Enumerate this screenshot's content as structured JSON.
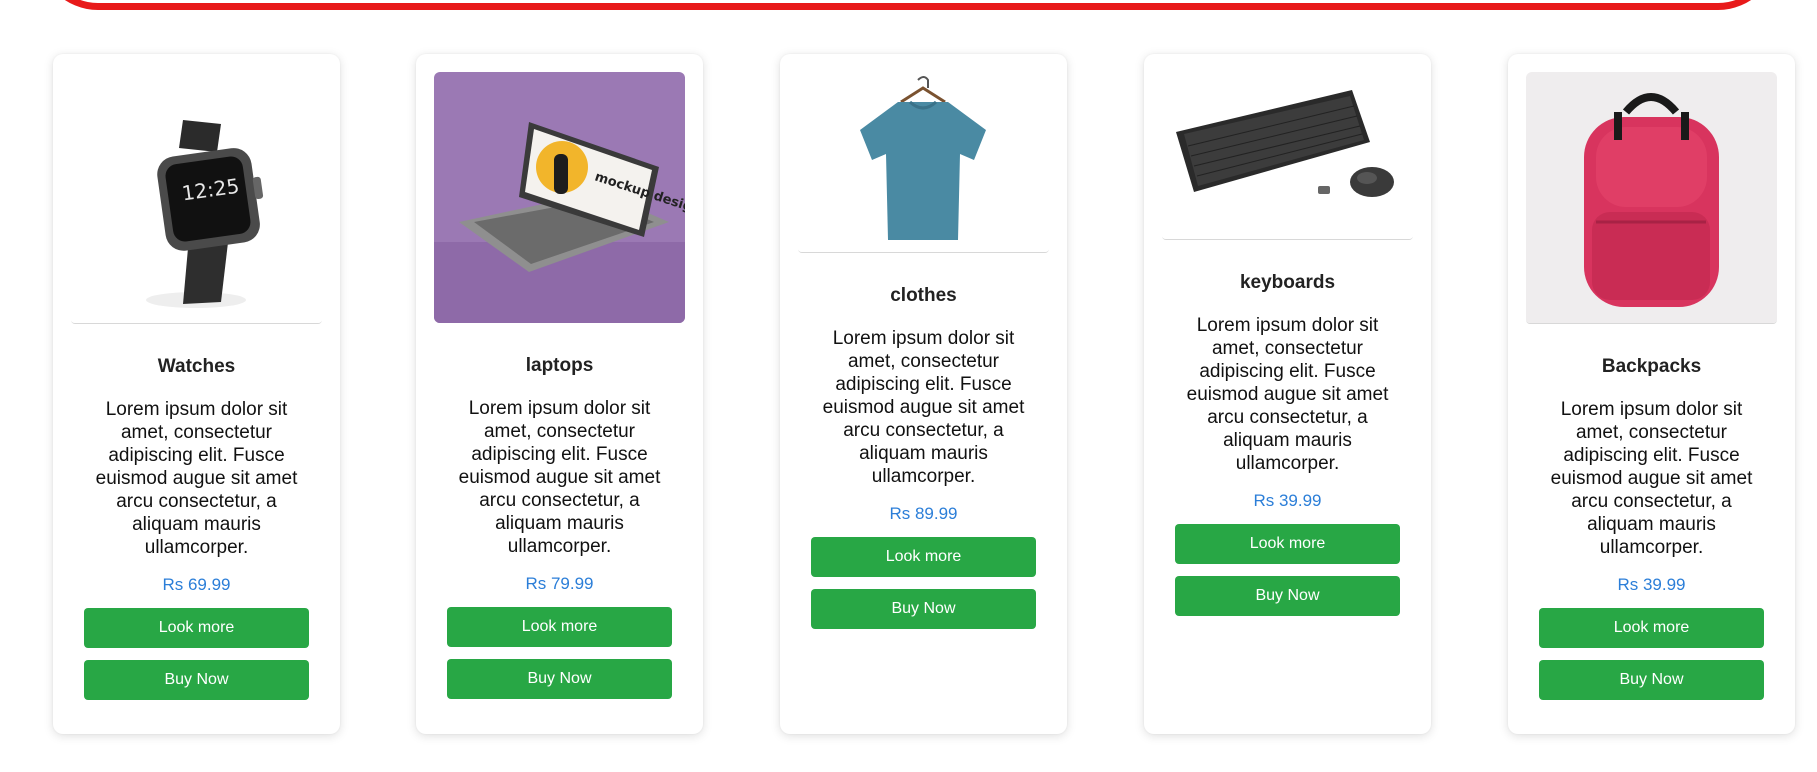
{
  "products": [
    {
      "name": "Watches",
      "description": "Lorem ipsum dolor sit amet, consectetur adipiscing elit. Fusce euismod augue sit amet arcu consectetur, a aliquam mauris ullamcorper.",
      "price": "Rs 69.99",
      "look_more_label": "Look more",
      "buy_now_label": "Buy Now",
      "image_icon": "smartwatch-image"
    },
    {
      "name": "laptops",
      "description": "Lorem ipsum dolor sit amet, consectetur adipiscing elit. Fusce euismod augue sit amet arcu consectetur, a aliquam mauris ullamcorper.",
      "price": "Rs 79.99",
      "look_more_label": "Look more",
      "buy_now_label": "Buy Now",
      "image_icon": "laptop-image",
      "image_text": "mockup design"
    },
    {
      "name": "clothes",
      "description": "Lorem ipsum dolor sit amet, consectetur adipiscing elit. Fusce euismod augue sit amet arcu consectetur, a aliquam mauris ullamcorper.",
      "price": "Rs 89.99",
      "look_more_label": "Look more",
      "buy_now_label": "Buy Now",
      "image_icon": "tshirt-image"
    },
    {
      "name": "keyboards",
      "description": "Lorem ipsum dolor sit amet, consectetur adipiscing elit. Fusce euismod augue sit amet arcu consectetur, a aliquam mauris ullamcorper.",
      "price": "Rs 39.99",
      "look_more_label": "Look more",
      "buy_now_label": "Buy Now",
      "image_icon": "keyboard-mouse-image"
    },
    {
      "name": "Backpacks",
      "description": "Lorem ipsum dolor sit amet, consectetur adipiscing elit. Fusce euismod augue sit amet arcu consectetur, a aliquam mauris ullamcorper.",
      "price": "Rs 39.99",
      "look_more_label": "Look more",
      "buy_now_label": "Buy Now",
      "image_icon": "backpack-image"
    }
  ],
  "colors": {
    "accent_button": "#28a745",
    "price": "#2b7ed8",
    "banner_border": "#e81a1a"
  }
}
